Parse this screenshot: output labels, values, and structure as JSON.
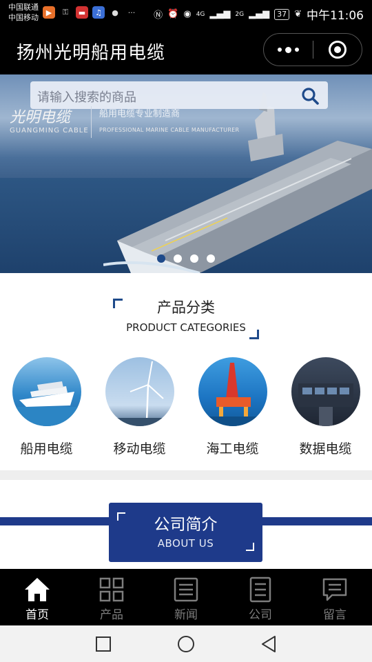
{
  "status_bar": {
    "carrier_1": "中国联通",
    "carrier_2": "中国移动",
    "network_1": "4G",
    "network_2": "2G",
    "battery": "37",
    "time": "中午11:06"
  },
  "header": {
    "title": "扬州光明船用电缆"
  },
  "banner": {
    "search_placeholder": "请输入搜索的商品",
    "brand_cn": "光明电缆",
    "brand_en": "GUANGMING CABLE",
    "slogan_cn": "船用电缆专业制造商",
    "slogan_en": "PROFESSIONAL MARINE CABLE MANUFACTURER",
    "slide_count": 4,
    "active_slide": 1
  },
  "categories": {
    "title_cn": "产品分类",
    "title_en": "PRODUCT CATEGORIES",
    "items": [
      {
        "label": "船用电缆",
        "image": "cruise-ship"
      },
      {
        "label": "移动电缆",
        "image": "wind-turbine"
      },
      {
        "label": "海工电缆",
        "image": "offshore-platform"
      },
      {
        "label": "数据电缆",
        "image": "cockpit-panel"
      }
    ]
  },
  "about": {
    "title_cn": "公司简介",
    "title_en": "ABOUT US"
  },
  "tabbar": {
    "items": [
      {
        "label": "首页",
        "icon": "home-icon",
        "active": true
      },
      {
        "label": "产品",
        "icon": "grid-icon",
        "active": false
      },
      {
        "label": "新闻",
        "icon": "news-icon",
        "active": false
      },
      {
        "label": "公司",
        "icon": "list-icon",
        "active": false
      },
      {
        "label": "留言",
        "icon": "message-icon",
        "active": false
      }
    ]
  },
  "colors": {
    "brand_blue": "#1e3a8a",
    "bar_black": "#000000",
    "tab_inactive": "#7d7d7d"
  }
}
